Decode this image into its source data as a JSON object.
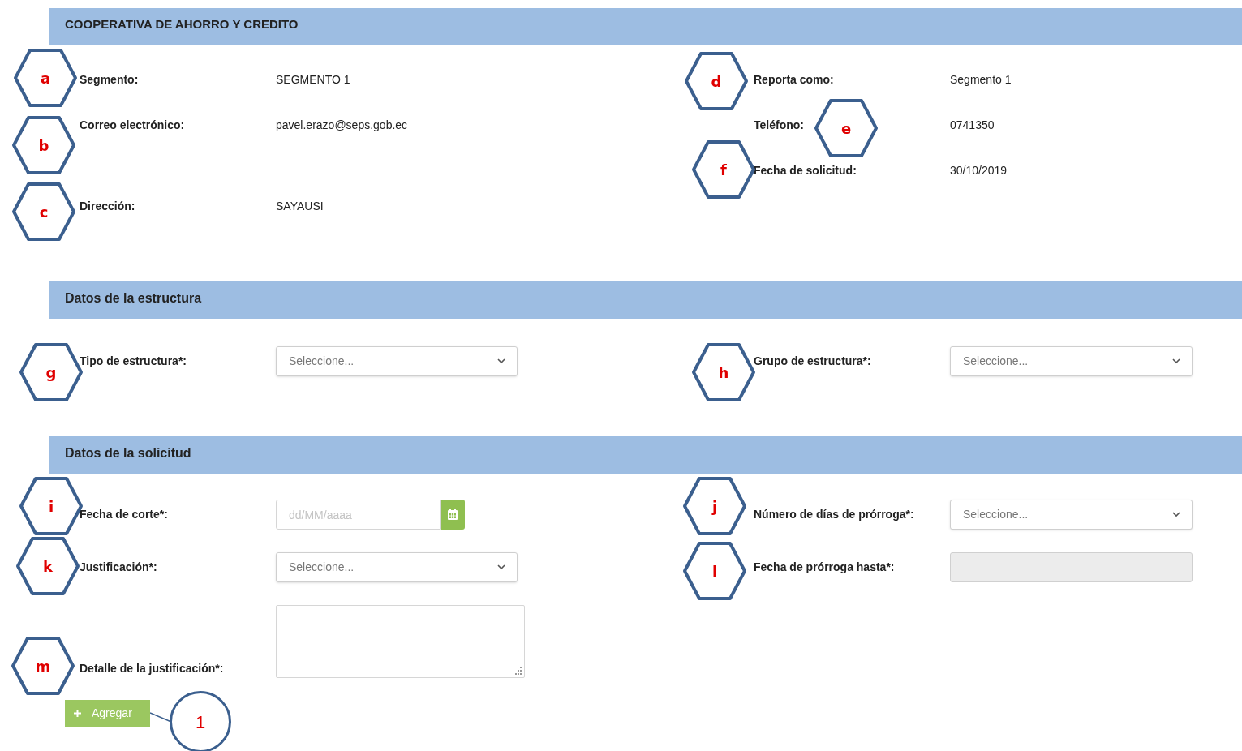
{
  "sections": [
    {
      "title": "COOPERATIVA DE AHORRO Y CREDITO",
      "kind": "info",
      "rows": [
        {
          "left": {
            "label": "Segmento:",
            "value": "SEGMENTO 1"
          },
          "right": {
            "label": "Reporta como:",
            "value": "Segmento 1"
          }
        },
        {
          "left": {
            "label": "Correo electrónico:",
            "value": "pavel.erazo@seps.gob.ec"
          },
          "right": {
            "label": "Teléfono:",
            "value": "0741350"
          }
        },
        {
          "right": {
            "label": "Fecha de solicitud:",
            "value": "30/10/2019"
          }
        },
        {
          "left": {
            "label": "Dirección:",
            "value": "SAYAUSI"
          }
        }
      ]
    },
    {
      "title": "Datos de la estructura",
      "kind": "form",
      "rows": [
        {
          "left": {
            "label": "Tipo de estructura*:",
            "kind": "select",
            "placeholder": "Seleccione..."
          },
          "right": {
            "label": "Grupo de estructura*:",
            "kind": "select",
            "placeholder": "Seleccione..."
          }
        }
      ]
    },
    {
      "title": "Datos de la solicitud",
      "kind": "form",
      "rows": [
        {
          "left": {
            "label": "Fecha de corte*:",
            "kind": "date",
            "placeholder": "dd/MM/aaaa"
          },
          "right": {
            "label": "Número de días de prórroga*:",
            "kind": "select",
            "placeholder": "Seleccione..."
          }
        },
        {
          "left": {
            "label": "Justificación*:",
            "kind": "select",
            "placeholder": "Seleccione..."
          },
          "right": {
            "label": "Fecha de prórroga hasta*:",
            "kind": "text",
            "disabled": true
          }
        },
        {
          "left": {
            "label": "Detalle de la justificación*:",
            "kind": "textarea"
          }
        }
      ]
    }
  ],
  "add_button": {
    "label": "Agregar"
  },
  "markers": [
    {
      "label": "a",
      "kind": "hexagon"
    },
    {
      "label": "b",
      "kind": "hexagon"
    },
    {
      "label": "c",
      "kind": "hexagon"
    },
    {
      "label": "d",
      "kind": "hexagon"
    },
    {
      "label": "e",
      "kind": "hexagon"
    },
    {
      "label": "f",
      "kind": "hexagon"
    },
    {
      "label": "g",
      "kind": "hexagon"
    },
    {
      "label": "h",
      "kind": "hexagon"
    },
    {
      "label": "i",
      "kind": "hexagon"
    },
    {
      "label": "j",
      "kind": "hexagon"
    },
    {
      "label": "k",
      "kind": "hexagon"
    },
    {
      "label": "l",
      "kind": "hexagon"
    },
    {
      "label": "m",
      "kind": "hexagon"
    },
    {
      "label": "1",
      "kind": "circle"
    }
  ]
}
